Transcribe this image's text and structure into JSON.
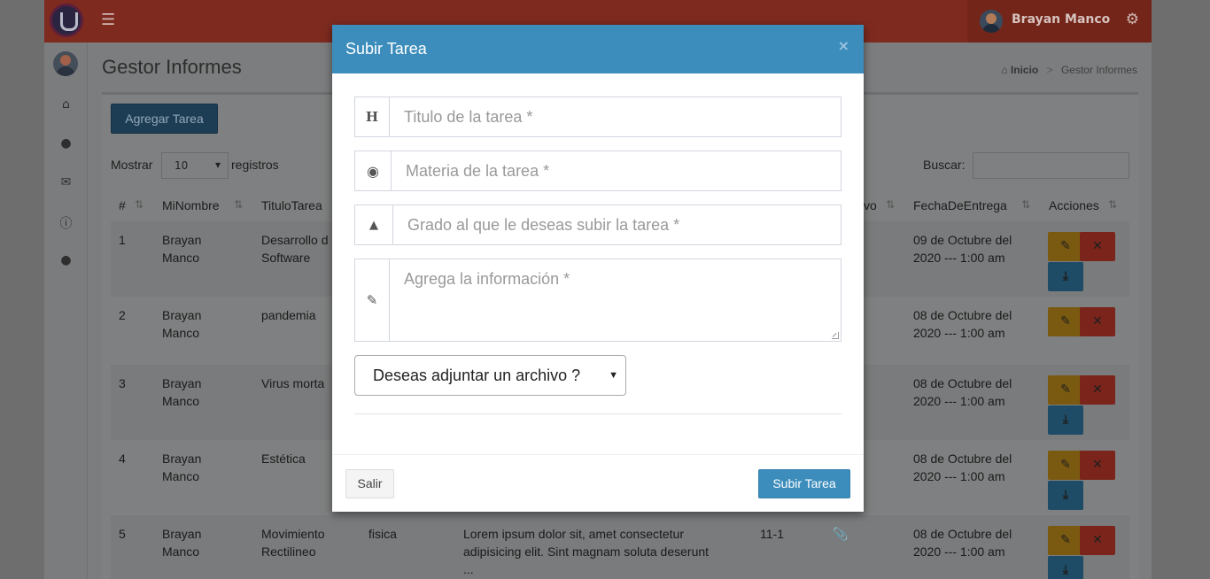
{
  "header": {
    "username": "Brayan Manco",
    "menu_icon": "hamburger-icon",
    "settings_icon": "gears-icon"
  },
  "sidebar": {
    "icons": [
      "home-icon",
      "user-icon",
      "envelope-icon",
      "info-icon",
      "user-icon"
    ]
  },
  "page": {
    "title": "Gestor Informes",
    "breadcrumb": {
      "home": "Inicio",
      "current": "Gestor Informes"
    }
  },
  "toolbar": {
    "add_label": "Agregar Tarea",
    "show_label": "Mostrar",
    "records_label": "registros",
    "page_length": "10",
    "search_label": "Buscar:"
  },
  "table": {
    "headers": [
      "#",
      "MiNombre",
      "TituloTarea",
      "vo",
      "FechaDeEntrega",
      "Acciones"
    ],
    "rows": [
      {
        "n": "1",
        "name1": "Brayan",
        "name2": "Manco",
        "t1": "Desarrollo d",
        "t2": "Software",
        "materia": "",
        "info1": "",
        "info2": "",
        "info3": "",
        "grado": "",
        "d1": "09 de Octubre del",
        "d2": "2020 --- 1:00 am"
      },
      {
        "n": "2",
        "name1": "Brayan",
        "name2": "Manco",
        "t1": "pandemia",
        "t2": "",
        "materia": "",
        "info1": "",
        "info2": "",
        "info3": "",
        "grado": "",
        "d1": "08 de Octubre del",
        "d2": "2020 --- 1:00 am"
      },
      {
        "n": "3",
        "name1": "Brayan",
        "name2": "Manco",
        "t1": "Virus morta",
        "t2": "",
        "materia": "",
        "info1": "",
        "info2": "",
        "info3": "",
        "grado": "",
        "d1": "08 de Octubre del",
        "d2": "2020 --- 1:00 am"
      },
      {
        "n": "4",
        "name1": "Brayan",
        "name2": "Manco",
        "t1": "Estética",
        "t2": "",
        "materia": "",
        "info1": "",
        "info2": "",
        "info3": "",
        "grado": "",
        "d1": "08 de Octubre del",
        "d2": "2020 --- 1:00 am"
      },
      {
        "n": "5",
        "name1": "Brayan",
        "name2": "Manco",
        "t1": "Movimiento",
        "t2": "Rectilineo",
        "materia": "fisica",
        "info1": "Lorem ipsum dolor sit, amet consectetur",
        "info2": "adipisicing elit. Sint magnam soluta deserunt",
        "info3": "...",
        "grado": "11-1",
        "d1": "08 de Octubre del",
        "d2": "2020 --- 1:00 am"
      }
    ]
  },
  "modal": {
    "title": "Subir Tarea",
    "close": "×",
    "fields": {
      "titulo_placeholder": "Titulo de la tarea *",
      "materia_placeholder": "Materia de la tarea *",
      "grado_placeholder": "Grado al que le deseas subir la tarea *",
      "info_placeholder": "Agrega la información *"
    },
    "attach_select": "Deseas adjuntar un archivo ?",
    "exit_label": "Salir",
    "submit_label": "Subir Tarea"
  },
  "colors": {
    "modal_header": "#3c8dbc",
    "submit_button": "#3c8dbc",
    "topbar": "#dd4b39"
  }
}
